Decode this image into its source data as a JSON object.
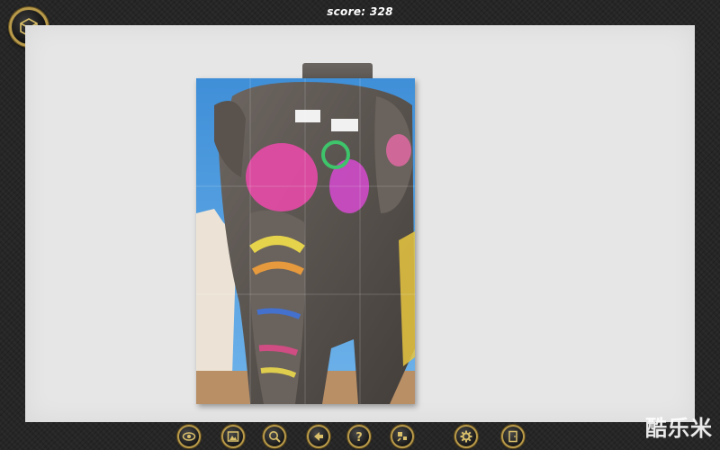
{
  "header": {
    "score_text": "score: 328"
  },
  "menu": {
    "icon": "cube-menu-icon"
  },
  "puzzle": {
    "subject": "painted elephant"
  },
  "toolbar": {
    "buttons": [
      {
        "name": "eye-icon"
      },
      {
        "name": "picture-icon"
      },
      {
        "name": "magnifier-icon"
      },
      {
        "name": "back-arrow-icon"
      },
      {
        "name": "help-icon"
      },
      {
        "name": "shuffle-pieces-icon"
      },
      {
        "name": "settings-gear-icon"
      },
      {
        "name": "exit-door-icon"
      }
    ]
  },
  "colors": {
    "accent_gold": "#b89a4a",
    "board": "#e6e6e6",
    "frame": "#262626"
  },
  "watermark": {
    "text": "酷乐米"
  }
}
